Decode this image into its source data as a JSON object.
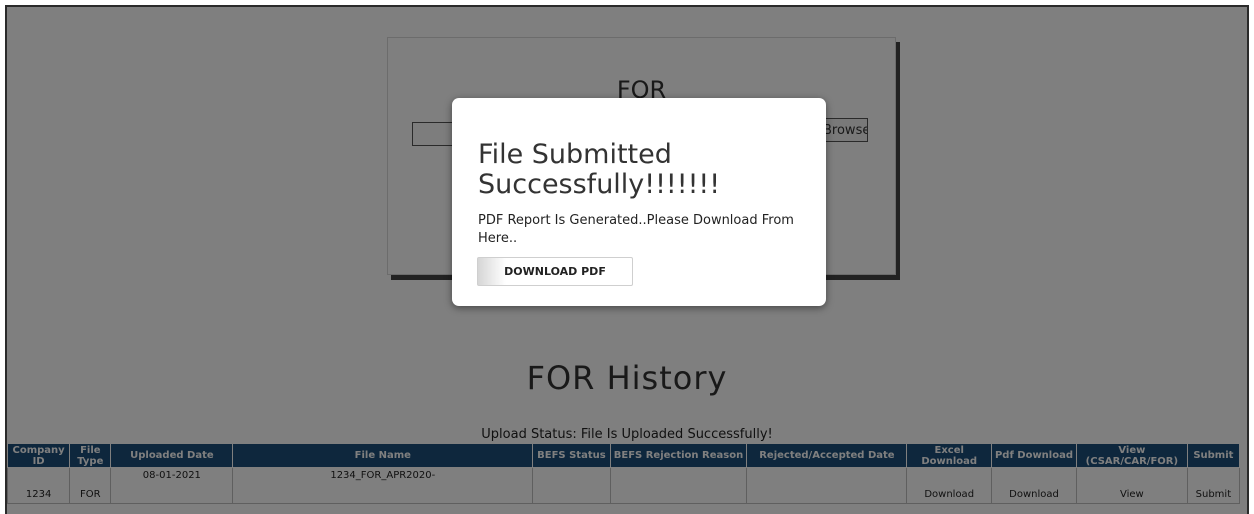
{
  "upload": {
    "title": "FOR",
    "browse_label": "Browse..."
  },
  "history": {
    "title": "FOR History",
    "status": "Upload Status: File Is Uploaded Successfully!",
    "columns": [
      "Company ID",
      "File Type",
      "Uploaded Date",
      "File Name",
      "BEFS Status",
      "BEFS Rejection Reason",
      "Rejected/Accepted Date",
      "Excel Download",
      "Pdf Download",
      "View (CSAR/CAR/FOR)",
      "Submit"
    ],
    "rows": [
      {
        "company_id": "1234",
        "file_type": "FOR",
        "uploaded_date": "08-01-2021",
        "file_name": "1234_FOR_APR2020-",
        "befs_status": "",
        "befs_reason": "",
        "rejected_date": "",
        "excel_download": "Download",
        "pdf_download": "Download",
        "view": "View",
        "submit": "Submit"
      }
    ]
  },
  "modal": {
    "title": "File Submitted Successfully!!!!!!!",
    "message": "PDF Report Is Generated..Please Download From Here..",
    "download_label": "DOWNLOAD PDF"
  },
  "colors": {
    "table_header": "#1c4f7b",
    "overlay": "rgba(0,0,0,0.5)"
  }
}
